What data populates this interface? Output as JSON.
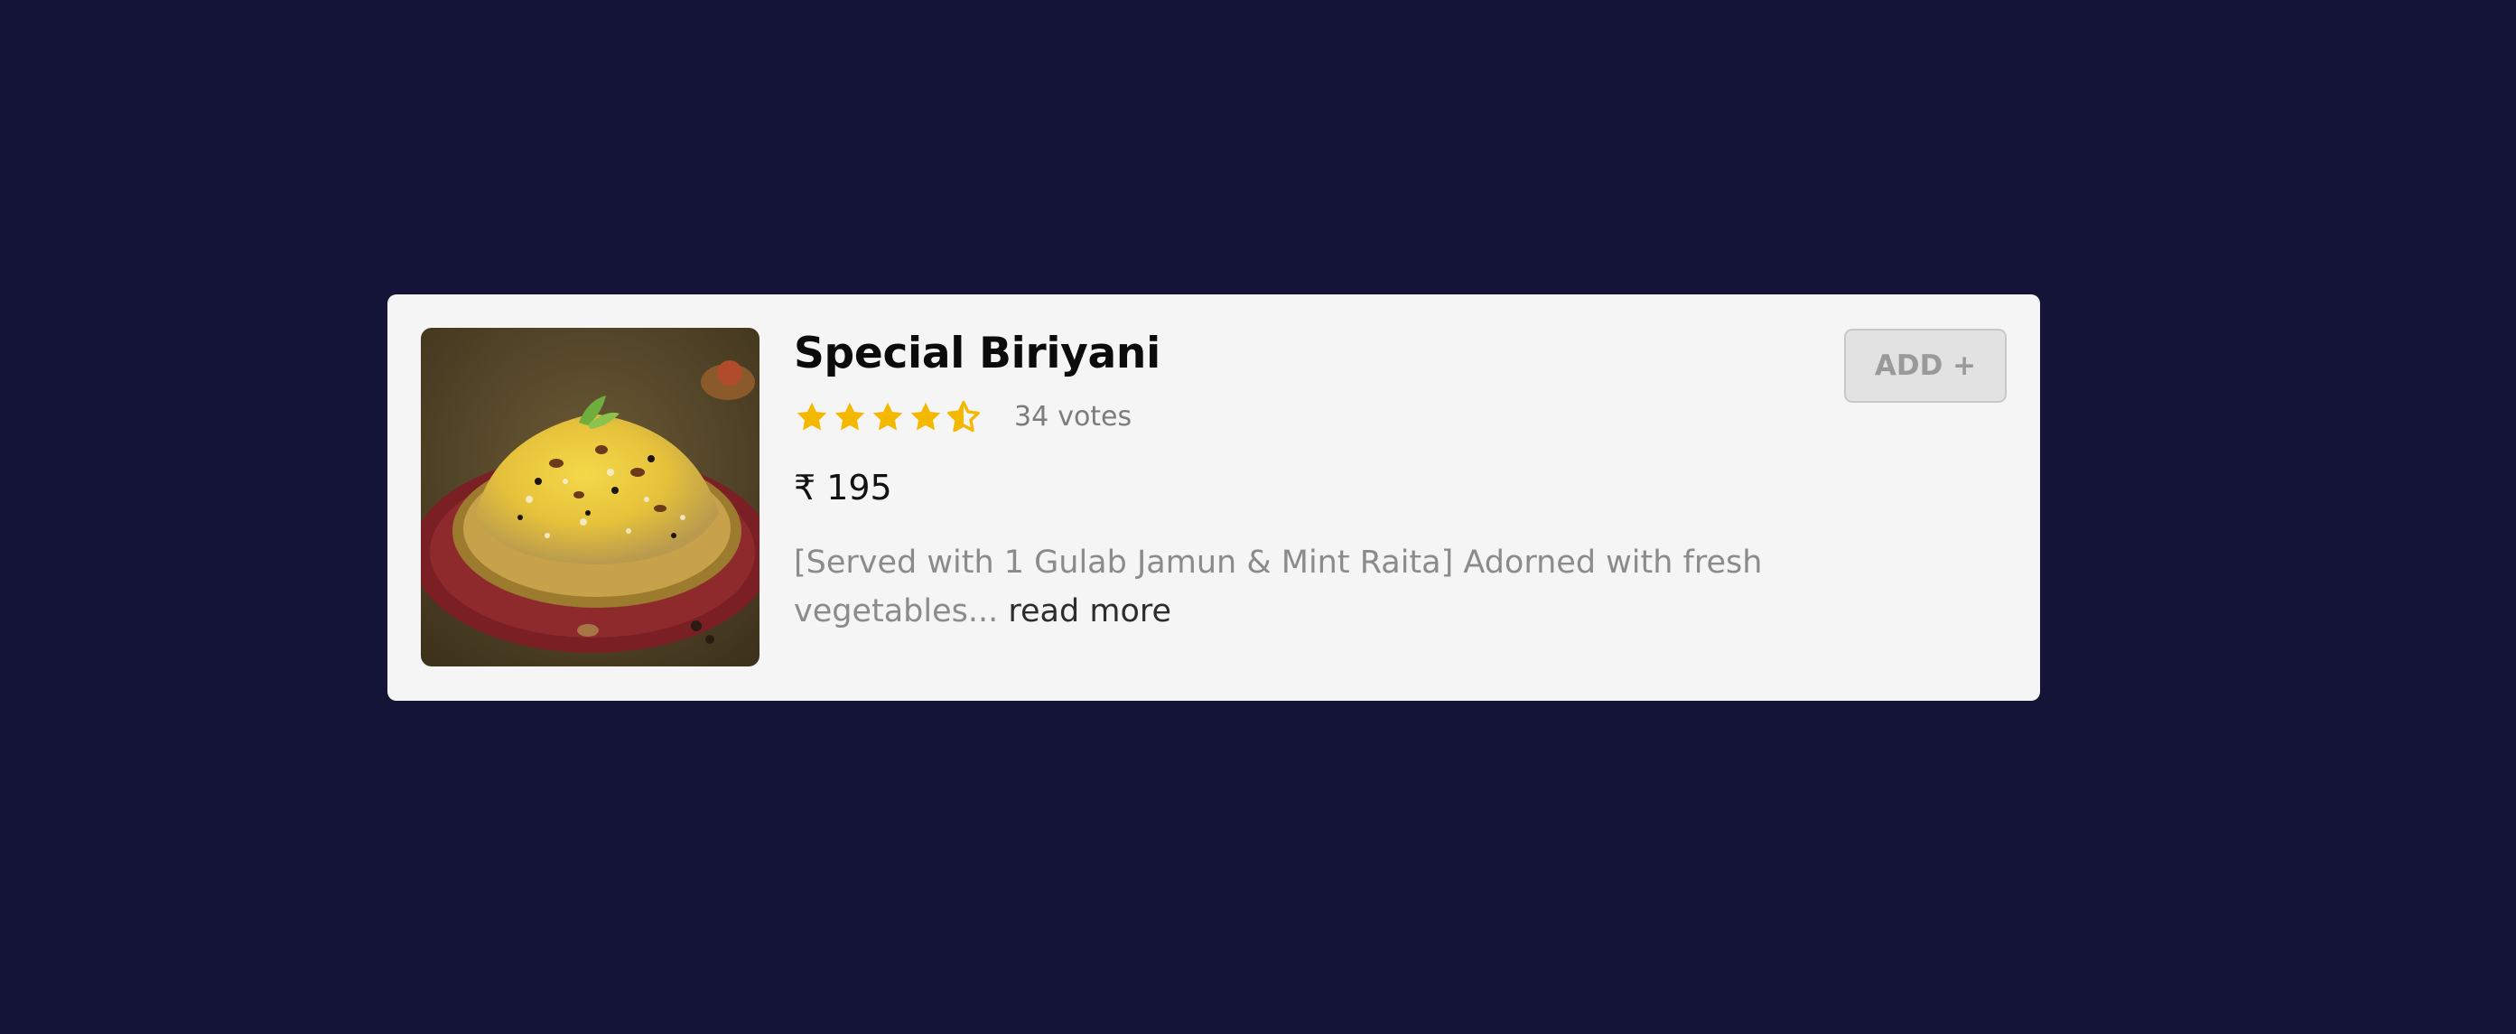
{
  "item": {
    "title": "Special Biriyani",
    "image_icon": "biriyani-photo",
    "rating": {
      "value": 4.5,
      "max": 5,
      "star_color": "#f5b800",
      "votes_count": "34",
      "votes_label": "votes"
    },
    "price": {
      "currency": "₹",
      "amount": "195"
    },
    "description": "[Served with 1 Gulab Jamun & Mint Raita] Adorned with fresh vegetables...",
    "read_more_label": "read more",
    "add_button_label": "ADD +"
  },
  "colors": {
    "background": "#141338",
    "card": "#f5f5f5",
    "star": "#f5b800"
  }
}
